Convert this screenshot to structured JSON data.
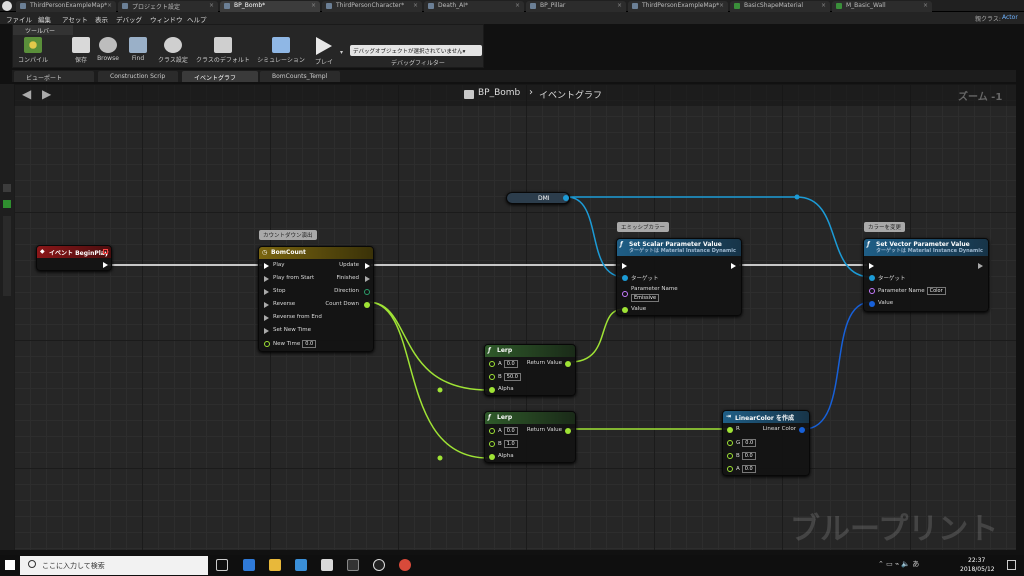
{
  "window_tabs": [
    "ThirdPersonExampleMap*",
    "プロジェクト設定",
    "BP_Bomb*",
    "ThirdPersonCharacter*",
    "Death_AI*",
    "BP_Pillar",
    "ThirdPersonExampleMap*",
    "BasicShapeMaterial",
    "M_Basic_Wall"
  ],
  "parent_class_label": "親クラス:",
  "parent_class_value": "Actor",
  "menu": [
    "ファイル",
    "編集",
    "アセット",
    "表示",
    "デバッグ",
    "ウィンドウ",
    "ヘルプ"
  ],
  "toolbar": {
    "panel_title": "ツールバー",
    "compile": "コンパイル",
    "save": "保存",
    "browse": "Browse",
    "find": "Find",
    "class_settings": "クラス設定",
    "class_defaults": "クラスのデフォルト",
    "simulation": "シミュレーション",
    "play": "プレイ",
    "debug_object": "デバッグオブジェクトが選択されていません▾",
    "debug_filter": "デバッグフィルター"
  },
  "subtabs": [
    "ビューポート",
    "Construction Scrip",
    "イベントグラフ",
    "BomCounts_Templ"
  ],
  "breadcrumb": {
    "blueprint": "BP_Bomb",
    "separator": "›",
    "graph": "イベントグラフ"
  },
  "zoom": "ズーム -1",
  "watermark": "ブループリント",
  "nodes": {
    "begin_play": {
      "title": "イベント BeginPlay"
    },
    "timeline": {
      "comment": "カウントダウン演出",
      "title": "BomCount",
      "pins_in": [
        "Play",
        "Play from Start",
        "Stop",
        "Reverse",
        "Reverse from End",
        "Set New Time",
        "New Time"
      ],
      "new_time": "0.0",
      "pins_out": [
        "Update",
        "Finished",
        "Direction",
        "Count Down"
      ]
    },
    "dmi": {
      "title": "DMI"
    },
    "set_scalar": {
      "comment": "エミッシブカラー",
      "title": "Set Scalar Parameter Value",
      "subtitle": "ターゲットは Material Instance Dynamic",
      "target": "ターゲット",
      "param_name_label": "Parameter Name",
      "param_name": "Emissive",
      "value": "Value"
    },
    "set_vector": {
      "comment": "カラーを変更",
      "title": "Set Vector Parameter Value",
      "subtitle": "ターゲットは Material Instance Dynamic",
      "target": "ターゲット",
      "param_name_label": "Parameter Name",
      "param_name": "Color",
      "value": "Value"
    },
    "lerp1": {
      "title": "Lerp",
      "a_label": "A",
      "a": "0.0",
      "b_label": "B",
      "b": "50.0",
      "alpha": "Alpha",
      "return": "Return Value"
    },
    "lerp2": {
      "title": "Lerp",
      "a_label": "A",
      "a": "0.0",
      "b_label": "B",
      "b": "1.0",
      "alpha": "Alpha",
      "return": "Return Value"
    },
    "linear_color": {
      "title": "LinearColor を作成",
      "r": "R",
      "g": "G",
      "g_val": "0.0",
      "b": "B",
      "b_val": "0.0",
      "a": "A",
      "a_val": "0.0",
      "out": "Linear Color"
    }
  },
  "taskbar": {
    "search_placeholder": "ここに入力して検索",
    "time": "22:37",
    "date": "2018/05/12"
  },
  "colors": {
    "exec": "#ffffff",
    "float": "#9fe335",
    "object": "#1c9bd6",
    "struct": "#1760d8",
    "name": "#c77bff",
    "event_head": "#8a1618",
    "func_head": "#1f5e86",
    "timeline_head": "#7a6510"
  }
}
